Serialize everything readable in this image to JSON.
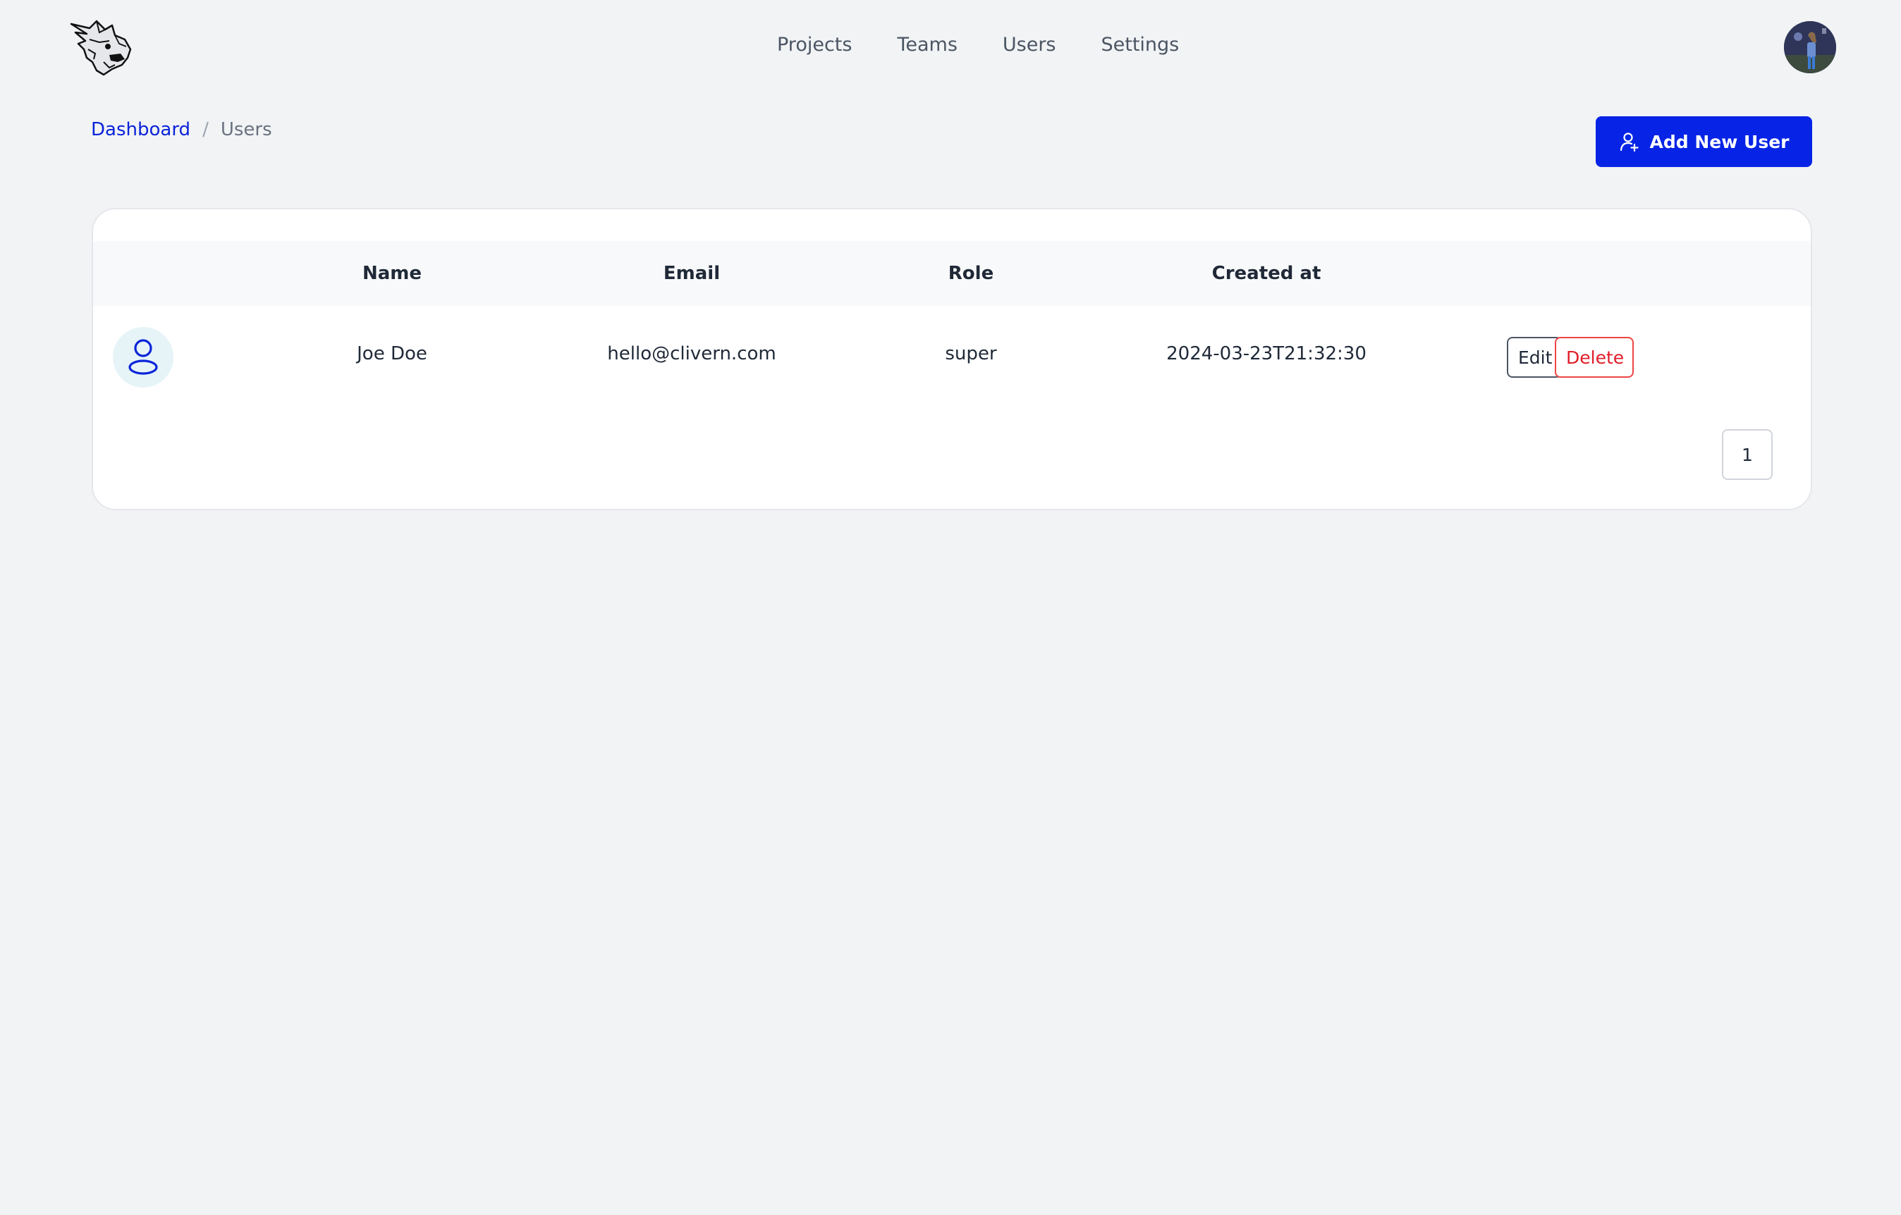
{
  "header": {
    "logo_icon": "lynx-logo-icon",
    "nav": [
      "Projects",
      "Teams",
      "Users",
      "Settings"
    ],
    "avatar_icon": "user-avatar"
  },
  "breadcrumb": {
    "items": [
      {
        "label": "Dashboard",
        "link": true
      },
      {
        "label": "Users",
        "link": false
      }
    ],
    "separator": "/"
  },
  "actions": {
    "add_user_label": "Add New User",
    "add_user_icon": "user-plus-icon"
  },
  "table": {
    "columns": [
      "Name",
      "Email",
      "Role",
      "Created at"
    ],
    "rows": [
      {
        "avatar_icon": "user-icon",
        "name": "Joe Doe",
        "email": "hello@clivern.com",
        "role": "super",
        "created_at": "2024-03-23T21:32:30",
        "edit_label": "Edit",
        "delete_label": "Delete"
      }
    ]
  },
  "pagination": {
    "current_page": "1"
  },
  "colors": {
    "accent": "#0724e6",
    "link": "#0b24d9",
    "danger": "#e11d28",
    "background": "#f1f3f5"
  }
}
